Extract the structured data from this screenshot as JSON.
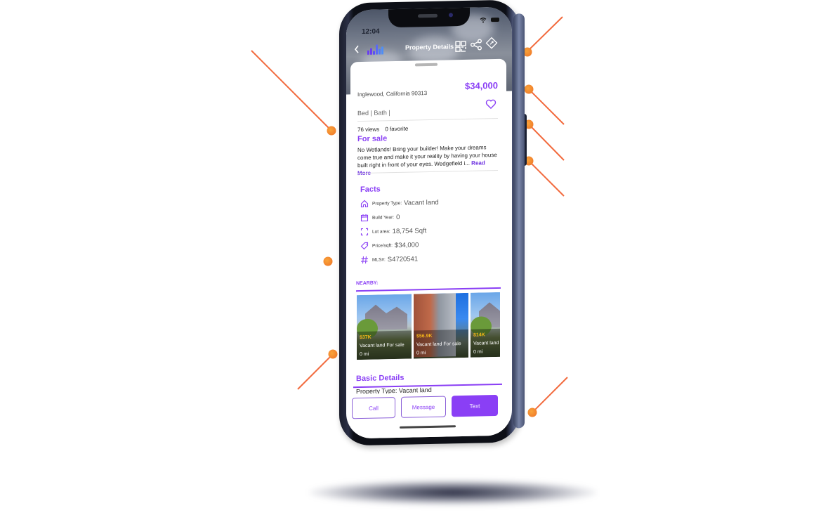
{
  "status_bar": {
    "time": "12:04"
  },
  "header": {
    "title": "Property Details",
    "back_icon": "chevron-left-icon",
    "logo": "brand-logo",
    "icons": [
      "qr-code-icon",
      "share-icon",
      "tag-icon"
    ]
  },
  "listing": {
    "address": "Inglewood, California 90313",
    "price": "$34,000",
    "bed_bath": "Bed |  Bath |",
    "views": "76 views",
    "favorites": "0 favorite",
    "status_title": "For sale",
    "description": "No Wetlands! Bring your builder! Make your dreams come true and make it your reality by having your house built right in front of your eyes. Wedgefield i...",
    "read_more": "Read More"
  },
  "facts": {
    "title": "Facts",
    "items": [
      {
        "icon": "home-icon",
        "label": "Property Type",
        "value": "Vacant land"
      },
      {
        "icon": "calendar-icon",
        "label": "Build Year",
        "value": "0"
      },
      {
        "icon": "expand-icon",
        "label": "Lot area",
        "value": "18,754 Sqft"
      },
      {
        "icon": "price-tag-icon",
        "label": "Price/sqft",
        "value": "$34,000"
      },
      {
        "icon": "hash-icon",
        "label": "MLS#",
        "value": "S4720541"
      }
    ]
  },
  "nearby": {
    "label": "NEARBY:",
    "cards": [
      {
        "price": "$37K",
        "type": "Vacant land For sale",
        "distance": "0 mi"
      },
      {
        "price": "$56.9K",
        "type": "Vacant land For sale",
        "distance": "0 mi"
      },
      {
        "price": "$14K",
        "type": "Vacant land For sale",
        "distance": "0 mi"
      }
    ]
  },
  "basic_details": {
    "title": "Basic Details",
    "first_row": "Property Type: Vacant land"
  },
  "actions": {
    "call": "Call",
    "message": "Message",
    "text": "Text"
  },
  "colors": {
    "accent": "#8a3ff5",
    "annotation": "#f26a3d",
    "annotation_dot": "#f7a02c"
  }
}
